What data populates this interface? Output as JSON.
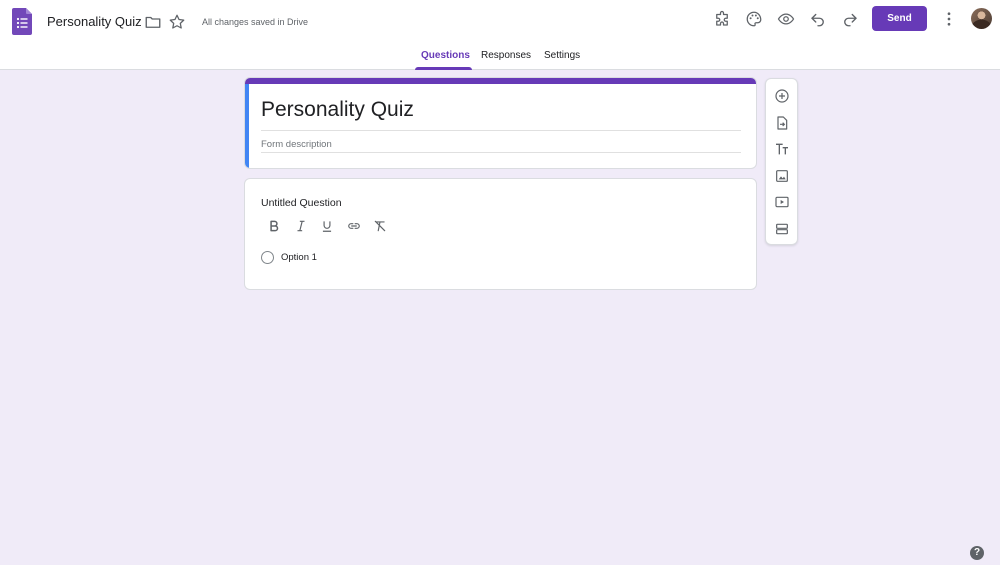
{
  "header": {
    "doc_title": "Personality Quiz",
    "save_status": "All changes saved in Drive",
    "send_label": "Send",
    "icons": [
      "forms-logo-icon",
      "folder-icon",
      "star-icon",
      "addon-puzzle-icon",
      "palette-icon",
      "preview-eye-icon",
      "undo-icon",
      "redo-icon",
      "more-vert-icon"
    ],
    "accent_color": "#673ab7"
  },
  "tabs": [
    {
      "label": "Questions",
      "active": true
    },
    {
      "label": "Responses",
      "active": false
    },
    {
      "label": "Settings",
      "active": false
    }
  ],
  "form": {
    "title": "Personality Quiz",
    "description_placeholder": "Form description"
  },
  "question": {
    "title": "Untitled Question",
    "format_tools": [
      "bold-icon",
      "italic-icon",
      "underline-icon",
      "link-icon",
      "clear-format-icon"
    ],
    "options": [
      {
        "label": "Option 1"
      }
    ]
  },
  "side_toolbar": {
    "items": [
      "add-question-icon",
      "import-questions-icon",
      "add-title-icon",
      "add-image-icon",
      "add-video-icon",
      "add-section-icon"
    ]
  },
  "help": {
    "label": "?"
  },
  "colors": {
    "background": "#f0ebf8",
    "title_bar": "#673ab7",
    "focus_bar": "#4285f4"
  }
}
